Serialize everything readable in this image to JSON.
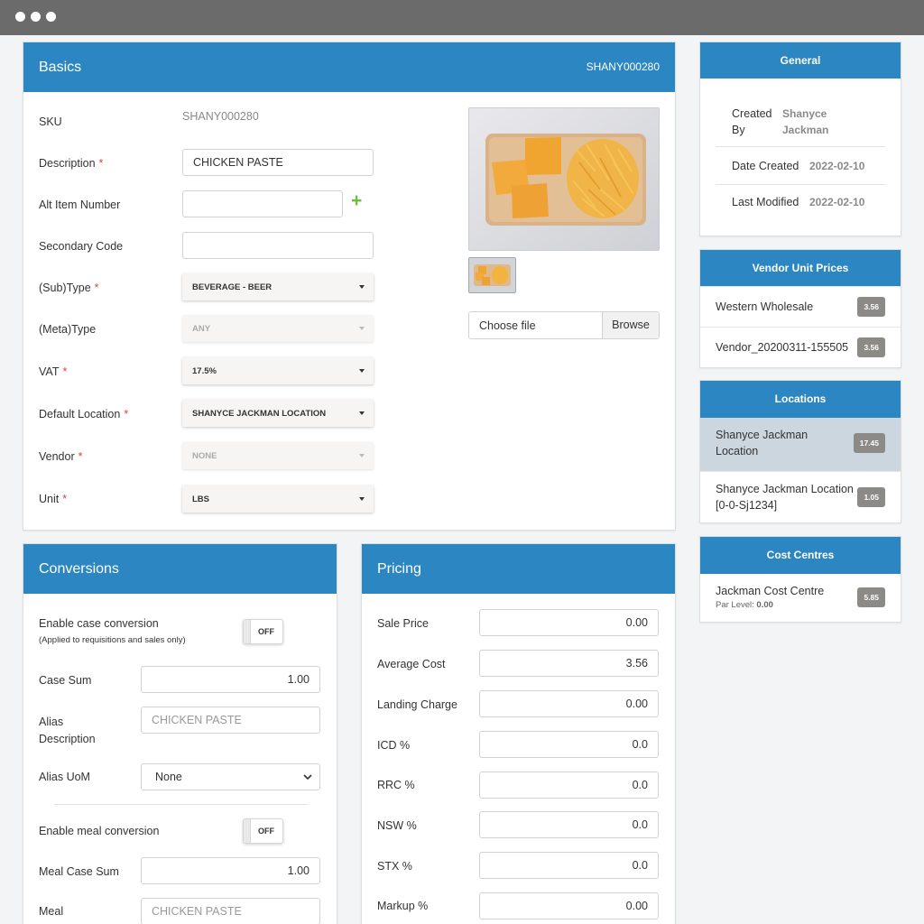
{
  "window": {
    "controls": [
      "dot",
      "dot",
      "dot"
    ]
  },
  "basics": {
    "title": "Basics",
    "sku_header": "SHANY000280",
    "sku_label": "SKU",
    "sku_value": "SHANY000280",
    "description_label": "Description",
    "description_value": "CHICKEN PASTE",
    "alt_item_label": "Alt Item Number",
    "alt_item_value": "",
    "add_icon": "+",
    "secondary_code_label": "Secondary Code",
    "secondary_code_value": "",
    "subtype_label": "(Sub)Type",
    "subtype_value": "BEVERAGE - BEER",
    "metatype_label": "(Meta)Type",
    "metatype_value": "ANY",
    "vat_label": "VAT",
    "vat_value": "17.5%",
    "default_location_label": "Default Location",
    "default_location_value": "SHANYCE JACKMAN LOCATION",
    "vendor_label": "Vendor",
    "vendor_value": "NONE",
    "unit_label": "Unit",
    "unit_value": "LBS",
    "required_mark": "*",
    "choose_file_label": "Choose file",
    "browse_label": "Browse"
  },
  "general": {
    "title": "General",
    "created_by_label_1": "Created",
    "created_by_label_2": "By",
    "created_by_value_1": "Shanyce",
    "created_by_value_2": "Jackman",
    "date_created_label": "Date Created",
    "date_created_value": "2022-02-10",
    "last_modified_label": "Last Modified",
    "last_modified_value": "2022-02-10"
  },
  "vendor_prices": {
    "title": "Vendor Unit Prices",
    "items": [
      {
        "name": "Western Wholesale",
        "price": "3.56"
      },
      {
        "name": "Vendor_20200311-155505",
        "price": "3.56"
      }
    ]
  },
  "locations": {
    "title": "Locations",
    "items": [
      {
        "line1": "Shanyce Jackman",
        "line2": "Location",
        "value": "17.45"
      },
      {
        "line1": "Shanyce Jackman Location",
        "line2": "[0-0-Sj1234]",
        "value": "1.05"
      }
    ]
  },
  "cost_centres": {
    "title": "Cost Centres",
    "items": [
      {
        "name": "Jackman Cost Centre",
        "par_label": "Par Level:",
        "par_value": "0.00",
        "value": "5.85"
      }
    ]
  },
  "conversions": {
    "title": "Conversions",
    "enable_case_label": "Enable case conversion",
    "enable_case_note": "(Applied to requisitions and sales only)",
    "case_toggle": "OFF",
    "case_sum_label": "Case Sum",
    "case_sum_value": "1.00",
    "alias_desc_label_1": "Alias",
    "alias_desc_label_2": "Description",
    "alias_desc_placeholder": "CHICKEN PASTE",
    "alias_uom_label": "Alias UoM",
    "alias_uom_value": "None",
    "enable_meal_label": "Enable meal conversion",
    "meal_toggle": "OFF",
    "meal_case_sum_label": "Meal Case Sum",
    "meal_case_sum_value": "1.00",
    "meal_desc_label_1": "Meal",
    "meal_desc_placeholder": "CHICKEN PASTE"
  },
  "pricing": {
    "title": "Pricing",
    "rows": [
      {
        "label": "Sale Price",
        "value": "0.00"
      },
      {
        "label": "Average Cost",
        "value": "3.56"
      },
      {
        "label": "Landing Charge",
        "value": "0.00"
      },
      {
        "label": "ICD %",
        "value": "0.0"
      },
      {
        "label": "RRC %",
        "value": "0.0"
      },
      {
        "label": "NSW %",
        "value": "0.0"
      },
      {
        "label": "STX %",
        "value": "0.0"
      },
      {
        "label": "Markup %",
        "value": "0.00"
      }
    ]
  },
  "colors": {
    "header": "#2b86c1",
    "required": "#d9453d",
    "add": "#6cbf3a",
    "badge": "#8c8a86",
    "selected_row": "#ccd6df"
  }
}
